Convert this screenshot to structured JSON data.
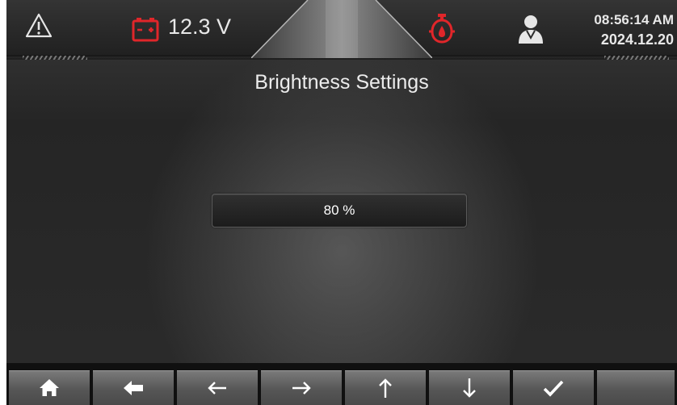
{
  "status": {
    "voltage": "12.3 V",
    "time": "08:56:14 AM",
    "date": "2024.12.20",
    "icons": [
      "warning-icon",
      "battery-icon",
      "oil-pressure-icon",
      "operator-icon"
    ],
    "colors": {
      "alarm_red": "#e0262a",
      "text": "#e8e8e8"
    }
  },
  "screen": {
    "title": "Brightness Settings",
    "brightness_value": "80 %",
    "brightness_level_percent": 80
  },
  "keys": [
    {
      "icon": "home-icon"
    },
    {
      "icon": "back-icon"
    },
    {
      "icon": "arrow-left-icon"
    },
    {
      "icon": "arrow-right-icon"
    },
    {
      "icon": "arrow-up-icon"
    },
    {
      "icon": "arrow-down-icon"
    },
    {
      "icon": "check-icon"
    },
    {
      "icon": "blank"
    }
  ]
}
